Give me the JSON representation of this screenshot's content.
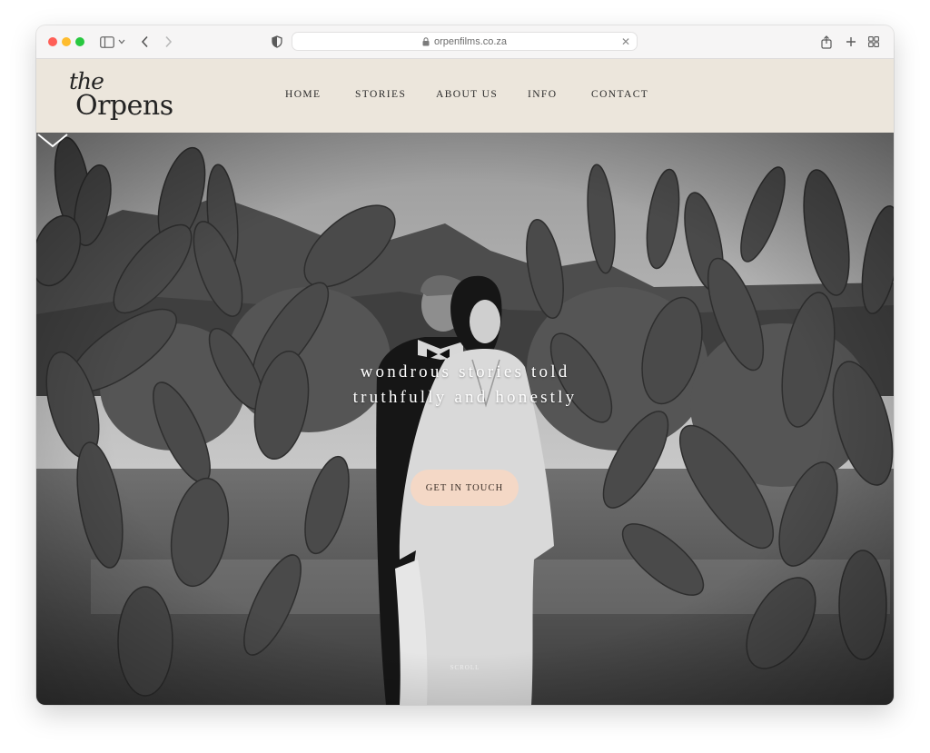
{
  "browser": {
    "url": "orpenfilms.co.za",
    "icons": {
      "sidebar": "sidebar-icon",
      "back": "chevron-left-icon",
      "forward": "chevron-right-icon",
      "privacy": "shield-icon",
      "lock": "lock-icon",
      "clear": "close-icon",
      "share": "share-icon",
      "new_tab": "plus-icon",
      "tab_overview": "grid-icon"
    }
  },
  "site": {
    "logo": {
      "line1": "the",
      "line2": "Orpens"
    },
    "nav": [
      "HOME",
      "STORIES",
      "ABOUT US",
      "INFO",
      "CONTACT"
    ]
  },
  "hero": {
    "tagline_line1": "wondrous stories told",
    "tagline_line2": "truthfully and honestly",
    "cta_label": "GET IN TOUCH",
    "scroll_label": "SCROLL",
    "scroll_icon": "chevron-down-icon"
  },
  "colors": {
    "header_bg": "#ece6dc",
    "cta_bg": "#f4d8c6",
    "text_dark": "#2a2a2a"
  }
}
